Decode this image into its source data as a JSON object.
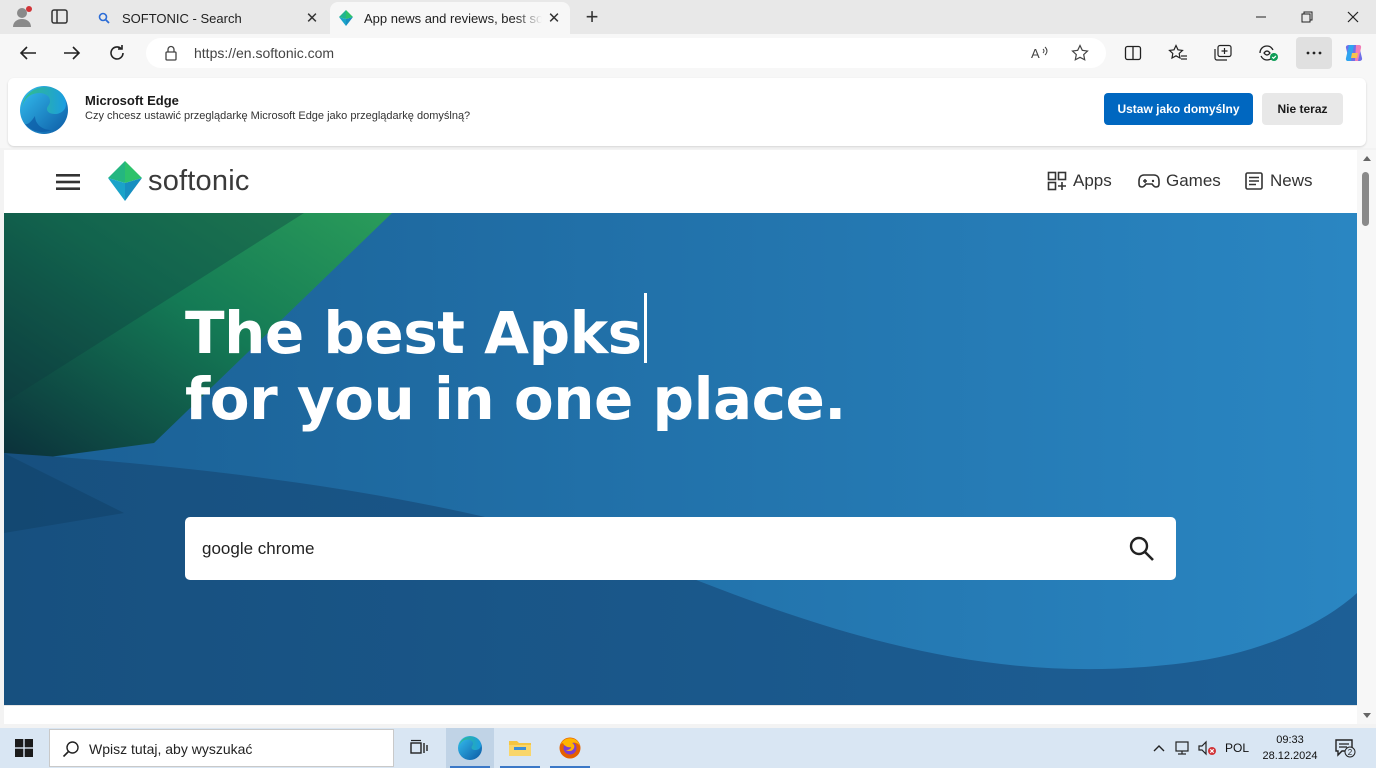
{
  "browser": {
    "tabs": [
      {
        "title": "SOFTONIC - Search",
        "favicon": "search-icon",
        "active": false
      },
      {
        "title": "App news and reviews, best software downloads and discovery",
        "favicon": "softonic-icon",
        "active": true
      }
    ],
    "address": "https://en.softonic.com"
  },
  "banner": {
    "title": "Microsoft Edge",
    "subtitle": "Czy chcesz ustawić przeglądarkę Microsoft Edge jako przeglądarkę domyślną?",
    "primary_label": "Ustaw jako domyślny",
    "secondary_label": "Nie teraz"
  },
  "site": {
    "brand": "softonic",
    "nav": [
      {
        "label": "Apps",
        "icon": "grid-icon"
      },
      {
        "label": "Games",
        "icon": "gamepad-icon"
      },
      {
        "label": "News",
        "icon": "newspaper-icon"
      }
    ],
    "headline_line1": "The best Apks",
    "headline_line2": "for you in one place.",
    "search_value": "google chrome"
  },
  "taskbar": {
    "search_placeholder": "Wpisz tutaj, aby wyszukać",
    "language": "POL",
    "time": "09:33",
    "date": "28.12.2024",
    "notification_count": "2"
  },
  "colors": {
    "accent_button": "#0067c0",
    "softonic_green": "#2dc26b",
    "softonic_teal": "#1aa3c9",
    "hero_blue": "#1d6ea6"
  }
}
